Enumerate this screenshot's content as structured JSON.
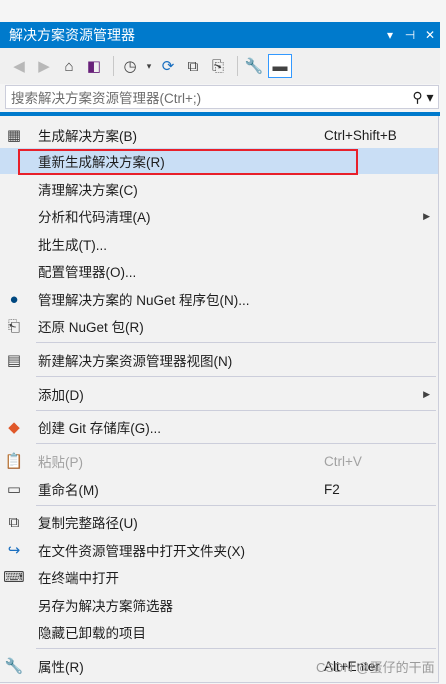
{
  "panel": {
    "title": "解决方案资源管理器",
    "title_buttons": [
      "▾",
      "⊣",
      "✕"
    ]
  },
  "search": {
    "placeholder": "搜索解决方案资源管理器(Ctrl+;)",
    "icon": "search-icon"
  },
  "menu": {
    "items": [
      {
        "label": "生成解决方案(B)",
        "shortcut": "Ctrl+Shift+B",
        "icon": "build-icon"
      },
      {
        "label": "重新生成解决方案(R)",
        "shortcut": "",
        "icon": ""
      },
      {
        "label": "清理解决方案(C)",
        "shortcut": "",
        "icon": ""
      },
      {
        "label": "分析和代码清理(A)",
        "shortcut": "",
        "icon": ""
      },
      {
        "label": "批生成(T)...",
        "shortcut": "",
        "icon": ""
      },
      {
        "label": "配置管理器(O)...",
        "shortcut": "",
        "icon": ""
      },
      {
        "label": "管理解决方案的 NuGet 程序包(N)...",
        "shortcut": "",
        "icon": "nuget-icon"
      },
      {
        "label": "还原 NuGet 包(R)",
        "shortcut": "",
        "icon": "restore-icon"
      },
      {
        "label": "新建解决方案资源管理器视图(N)",
        "shortcut": "",
        "icon": "new-view-icon"
      },
      {
        "label": "添加(D)",
        "shortcut": "",
        "icon": ""
      },
      {
        "label": "创建 Git 存储库(G)...",
        "shortcut": "",
        "icon": "git-icon"
      },
      {
        "label": "粘贴(P)",
        "shortcut": "Ctrl+V",
        "icon": "paste-icon"
      },
      {
        "label": "重命名(M)",
        "shortcut": "F2",
        "icon": "rename-icon"
      },
      {
        "label": "复制完整路径(U)",
        "shortcut": "",
        "icon": "copy-icon"
      },
      {
        "label": "在文件资源管理器中打开文件夹(X)",
        "shortcut": "",
        "icon": "open-folder-icon"
      },
      {
        "label": "在终端中打开",
        "shortcut": "",
        "icon": "terminal-icon"
      },
      {
        "label": "另存为解决方案筛选器",
        "shortcut": "",
        "icon": ""
      },
      {
        "label": "隐藏已卸载的项目",
        "shortcut": "",
        "icon": ""
      },
      {
        "label": "属性(R)",
        "shortcut": "Alt+Enter",
        "icon": "wrench-icon"
      }
    ]
  },
  "watermark": "CSDN @蛋仔的干面"
}
